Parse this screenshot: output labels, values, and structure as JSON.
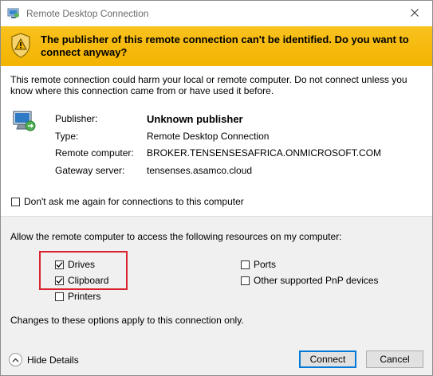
{
  "window": {
    "title": "Remote Desktop Connection"
  },
  "banner": {
    "message": "The publisher of this remote connection can't be identified. Do you want to connect anyway?"
  },
  "warning_description": "This remote connection could harm your local or remote computer. Do not connect unless you know where this connection came from or have used it before.",
  "details": [
    {
      "label": "Publisher:",
      "value": "Unknown publisher"
    },
    {
      "label": "Type:",
      "value": "Remote Desktop Connection"
    },
    {
      "label": "Remote computer:",
      "value": "BROKER.TENSENSESAFRICA.ONMICROSOFT.COM"
    },
    {
      "label": "Gateway server:",
      "value": "tensenses.asamco.cloud"
    }
  ],
  "dont_ask": {
    "label": "Don't ask me again for connections to this computer",
    "checked": false
  },
  "resources": {
    "heading": "Allow the remote computer to access the following resources on my computer:",
    "items": [
      {
        "label": "Drives",
        "checked": true
      },
      {
        "label": "Clipboard",
        "checked": true
      },
      {
        "label": "Printers",
        "checked": false
      },
      {
        "label": "Ports",
        "checked": false
      },
      {
        "label": "Other supported PnP devices",
        "checked": false
      }
    ],
    "note": "Changes to these options apply to this connection only."
  },
  "footer": {
    "hide_details": "Hide Details",
    "connect": "Connect",
    "cancel": "Cancel"
  },
  "colors": {
    "banner": "#f3b300",
    "highlight": "#d9232e",
    "default_button_border": "#0078d7"
  }
}
